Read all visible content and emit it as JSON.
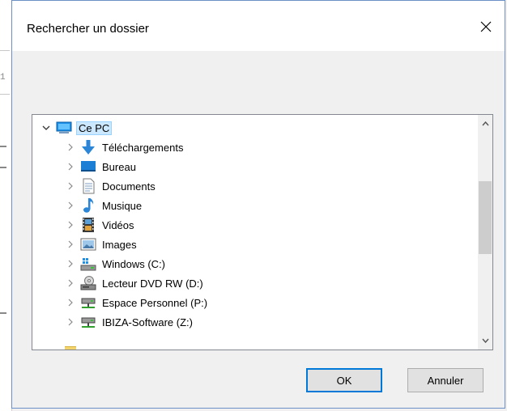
{
  "dialog": {
    "title": "Rechercher un dossier",
    "close_icon": "close-icon"
  },
  "background": {
    "fragment_char": "1"
  },
  "tree": {
    "root": {
      "label": "Ce PC",
      "icon": "computer-icon",
      "expanded": true,
      "selected": true
    },
    "items": [
      {
        "label": "Téléchargements",
        "icon": "downloads-icon"
      },
      {
        "label": "Bureau",
        "icon": "desktop-icon"
      },
      {
        "label": "Documents",
        "icon": "documents-icon"
      },
      {
        "label": "Musique",
        "icon": "music-icon"
      },
      {
        "label": "Vidéos",
        "icon": "videos-icon"
      },
      {
        "label": "Images",
        "icon": "images-icon"
      },
      {
        "label": "Windows (C:)",
        "icon": "system-drive-icon"
      },
      {
        "label": "Lecteur DVD RW (D:)",
        "icon": "dvd-drive-icon"
      },
      {
        "label": "Espace Personnel (P:)",
        "icon": "network-drive-icon"
      },
      {
        "label": "IBIZA-Software (Z:)",
        "icon": "network-drive-icon"
      }
    ]
  },
  "buttons": {
    "ok": "OK",
    "cancel": "Annuler"
  },
  "colors": {
    "selection": "#cce8ff",
    "accent": "#0078d7"
  }
}
